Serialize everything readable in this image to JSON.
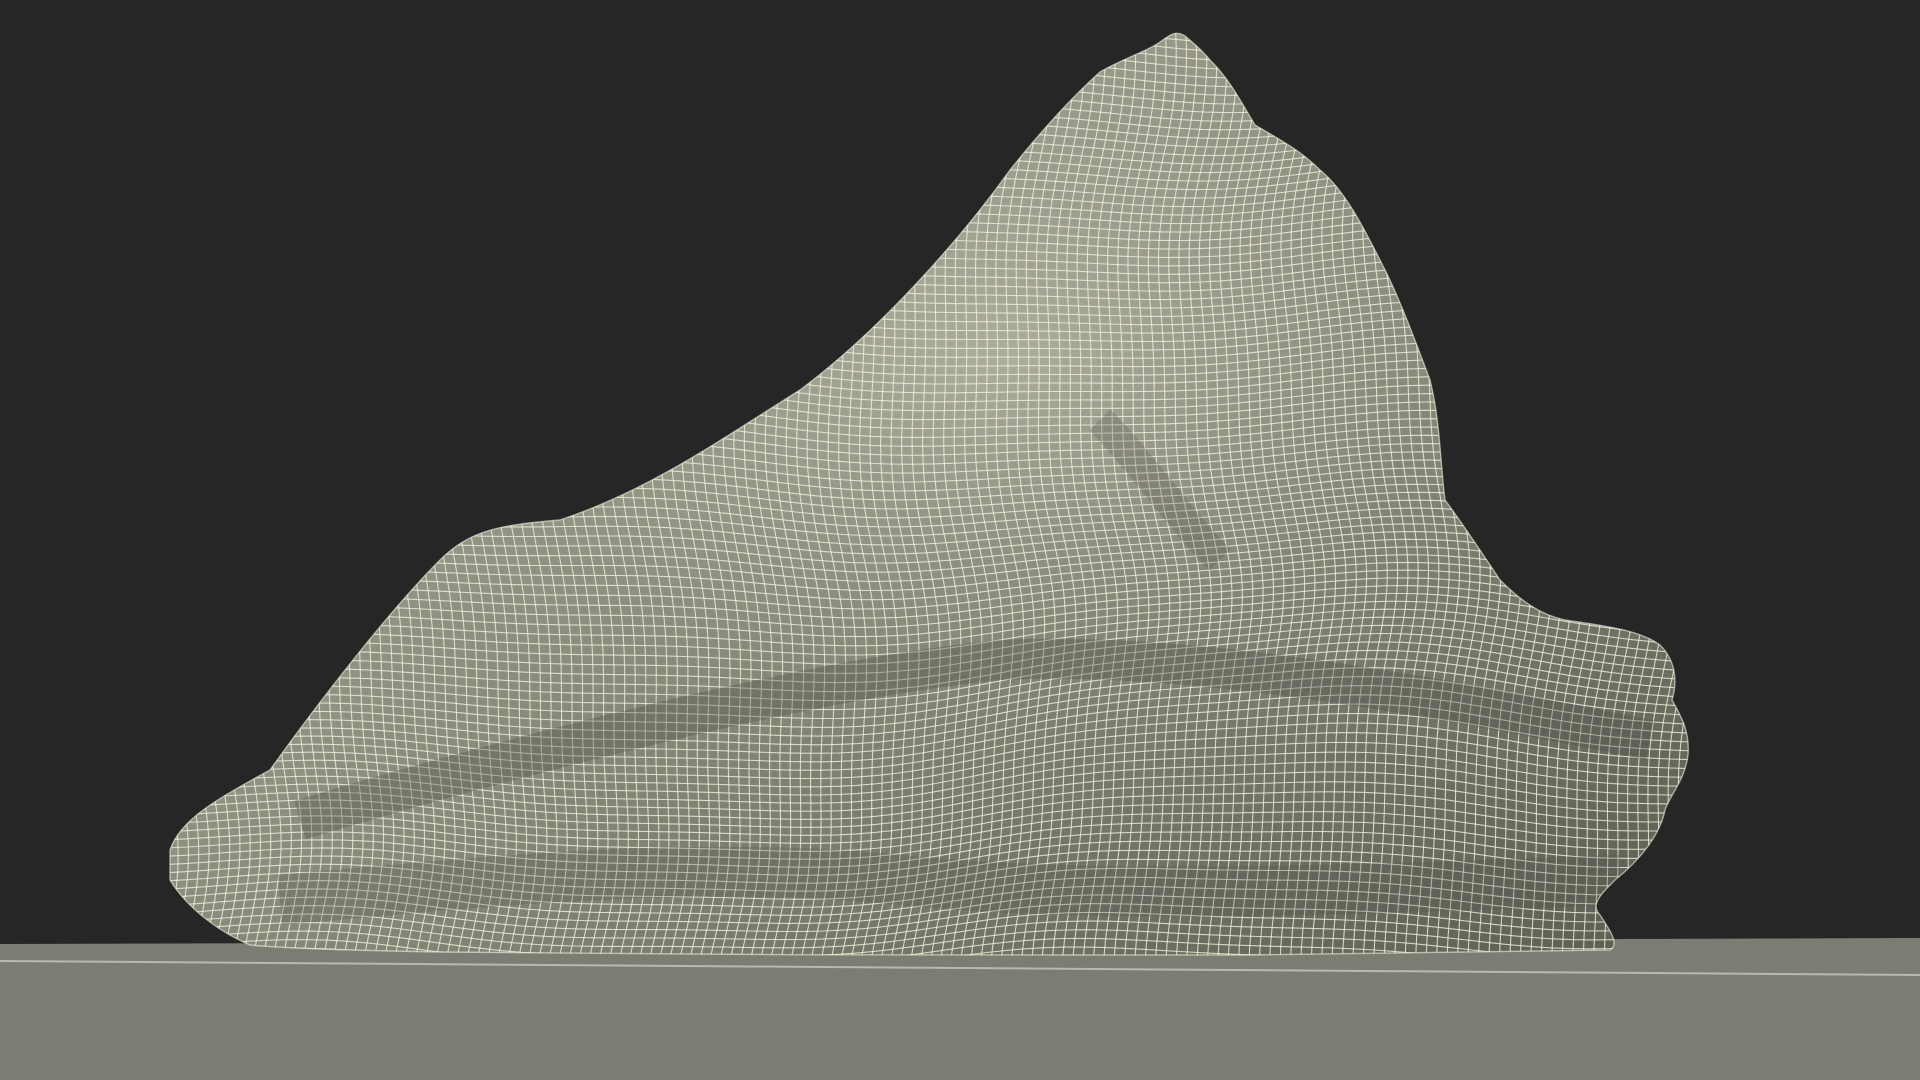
{
  "scene": {
    "subject": "rock-wireframe",
    "colors": {
      "background": "#262626",
      "ground": "#7b7d72",
      "ground_edge": "#9c9e92",
      "surface_light": "#b5b6a6",
      "surface_mid": "#8d8f80",
      "surface_dark": "#5c5e53",
      "wire": "#f2f0dc"
    }
  }
}
